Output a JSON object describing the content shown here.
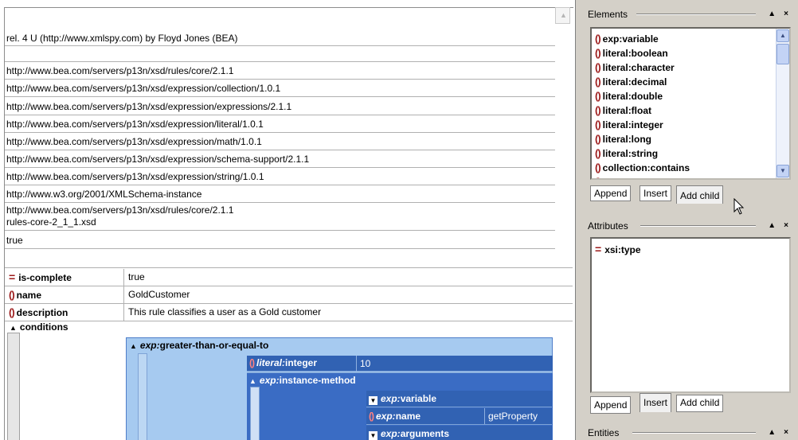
{
  "grid": {
    "rows": [
      "rel. 4 U (http://www.xmlspy.com) by Floyd Jones (BEA)",
      "",
      "http://www.bea.com/servers/p13n/xsd/rules/core/2.1.1",
      "http://www.bea.com/servers/p13n/xsd/expression/collection/1.0.1",
      "http://www.bea.com/servers/p13n/xsd/expression/expressions/2.1.1",
      "http://www.bea.com/servers/p13n/xsd/expression/literal/1.0.1",
      "http://www.bea.com/servers/p13n/xsd/expression/math/1.0.1",
      "http://www.bea.com/servers/p13n/xsd/expression/schema-support/2.1.1",
      "http://www.bea.com/servers/p13n/xsd/expression/string/1.0.1",
      "http://www.w3.org/2001/XMLSchema-instance"
    ],
    "schema_location_line1": "http://www.bea.com/servers/p13n/xsd/rules/core/2.1.1",
    "schema_location_line2": "rules-core-2_1_1.xsd",
    "true_row": "true",
    "props": [
      {
        "icon": "attribute-icon",
        "name": "is-complete",
        "value": "true"
      },
      {
        "icon": "element-icon",
        "name": "name",
        "value": "GoldCustomer"
      },
      {
        "icon": "element-icon",
        "name": "description",
        "value": "This rule classifies a user as a Gold customer"
      }
    ],
    "conditions_label": "conditions",
    "gte": {
      "prefix": "exp:",
      "name": "greater-than-or-equal-to"
    },
    "literal": {
      "prefix": "literal:",
      "name": "integer",
      "value": "10"
    },
    "instance_method": {
      "prefix": "exp:",
      "name": "instance-method"
    },
    "inner_rows": [
      {
        "prefix": "exp:",
        "name": "variable",
        "value": "",
        "icon": "dropdown-icon"
      },
      {
        "prefix": "exp:",
        "name": "name",
        "value": "getProperty",
        "icon": "element-icon"
      },
      {
        "prefix": "exp:",
        "name": "arguments",
        "value": "",
        "icon": "dropdown-icon"
      }
    ]
  },
  "elements_panel": {
    "title": "Elements",
    "items": [
      "exp:variable",
      "literal:boolean",
      "literal:character",
      "literal:decimal",
      "literal:double",
      "literal:float",
      "literal:integer",
      "literal:long",
      "literal:string",
      "collection:contains"
    ],
    "tabs": [
      "Append",
      "Insert",
      "Add child"
    ]
  },
  "attributes_panel": {
    "title": "Attributes",
    "items": [
      "xsi:type"
    ],
    "tabs": [
      "Append",
      "Insert",
      "Add child"
    ]
  },
  "entities_panel": {
    "title": "Entities"
  },
  "panel_buttons": {
    "pin": "▲",
    "close": "×"
  },
  "colors": {
    "selection": "#3162b3",
    "light_blue": "#a6caf0",
    "icon_red": "#9c1a1a",
    "panel_bg": "#d4d0c8"
  }
}
